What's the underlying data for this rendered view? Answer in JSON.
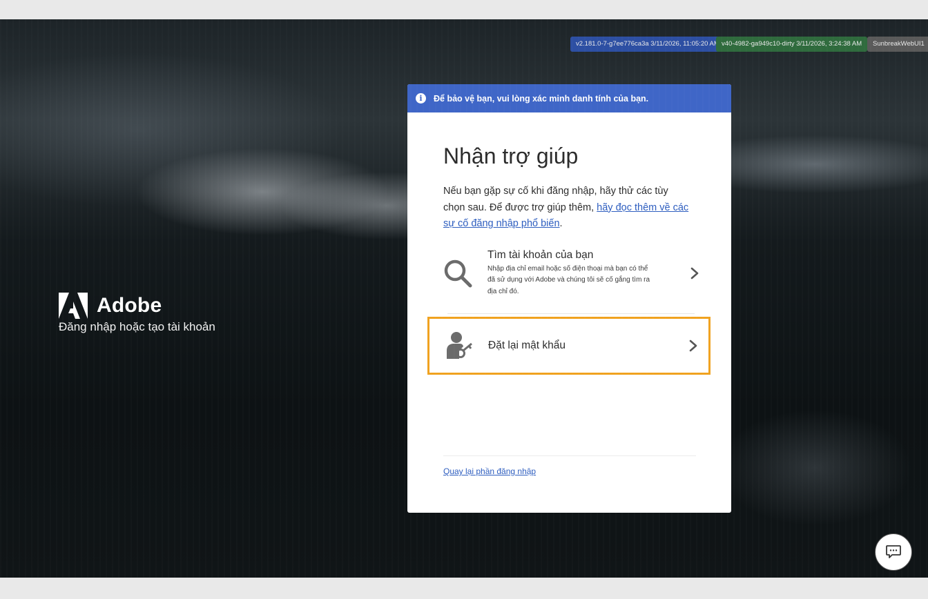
{
  "build_badges": [
    "v2.181.0-7-g7ee776ca3a 3/11/2026, 11:05:20 AM",
    "v40-4982-ga949c10-dirty 3/11/2026, 3:24:38 AM",
    "SunbreakWebUI1"
  ],
  "brand": {
    "name": "Adobe",
    "tagline": "Đăng nhập hoặc tạo tài khoản"
  },
  "notice": {
    "text": "Để bảo vệ bạn, vui lòng xác minh danh tính của bạn."
  },
  "card": {
    "title": "Nhận trợ giúp",
    "desc_prefix": "Nếu bạn gặp sự cố khi đăng nhập, hãy thử các tùy chọn sau. Để được trợ giúp thêm, ",
    "desc_link": "hãy đọc thêm về các sự cố đăng nhập phổ biến",
    "desc_suffix": "."
  },
  "options": {
    "find_account": {
      "title": "Tìm tài khoản của bạn",
      "subtitle": "Nhập địa chỉ email hoặc số điện thoại mà bạn có thể đã sử dụng với Adobe và chúng tôi sẽ cố gắng tìm ra địa chỉ đó.",
      "icon": "search-icon"
    },
    "reset_password": {
      "title": "Đặt lại mật khẩu",
      "icon": "user-key-icon"
    }
  },
  "back_link": "Quay lại phần đăng nhập",
  "colors": {
    "notice_bg": "#3f66c7",
    "highlight_border": "#f0a21f",
    "link": "#2d5dbf"
  }
}
